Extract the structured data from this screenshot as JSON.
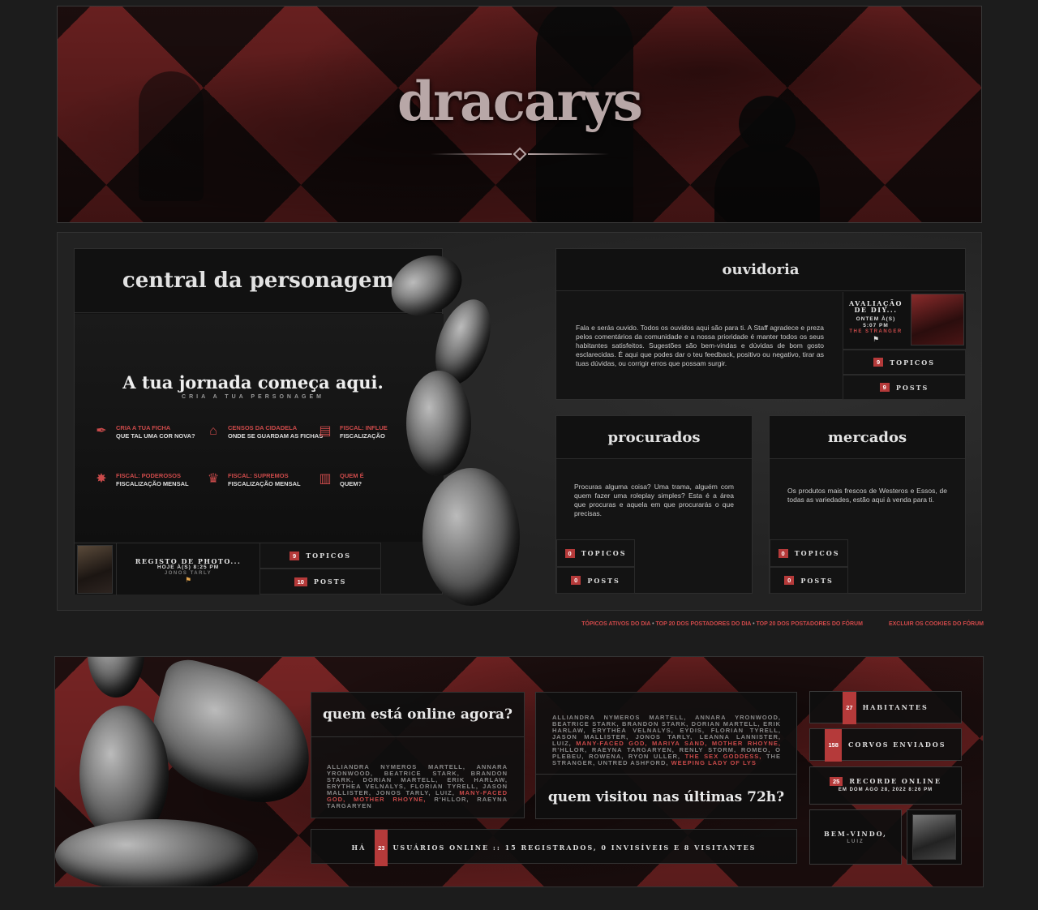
{
  "header": {
    "site_title": "dracarys"
  },
  "central": {
    "title": "central da personagem",
    "journey_title": "A tua jornada começa aqui.",
    "journey_subtitle": "CRIA A TUA PERSONAGEM",
    "links": [
      {
        "icon": "quill-icon",
        "glyph": "✒",
        "title": "CRIA A TUA FICHA",
        "subtitle": "QUE TAL UMA COR NOVA?"
      },
      {
        "icon": "building-icon",
        "glyph": "🏛",
        "title": "CENSOS DA CIDADELA",
        "subtitle": "ONDE SE GUARDAM AS FICHAS"
      },
      {
        "icon": "scroll-icon",
        "glyph": "📜",
        "title": "FISCAL: INFLUE",
        "subtitle": "FISCALIZAÇÃO"
      },
      {
        "icon": "compass-star-icon",
        "glyph": "✸",
        "title": "FISCAL: PODEROSOS",
        "subtitle": "FISCALIZAÇÃO MENSAL"
      },
      {
        "icon": "crown-icon",
        "glyph": "♛",
        "title": "FISCAL: SUPREMOS",
        "subtitle": "FISCALIZAÇÃO MENSAL"
      },
      {
        "icon": "books-icon",
        "glyph": "📚",
        "title": "QUEM É",
        "subtitle": "QUEM?"
      }
    ],
    "last_post": {
      "title": "REGISTO DE PHOTO...",
      "date": "HOJE À(S) 8:25 PM",
      "user": "JONOS TARLY"
    },
    "topics": "9",
    "topics_label": "TOPICOS",
    "posts": "10",
    "posts_label": "POSTS"
  },
  "ouvidoria": {
    "title": "ouvidoria",
    "description": "Fala e serás ouvido. Todos os ouvidos aqui são para ti. A Staff agradece e preza pelos comentários da comunidade e a nossa prioridade é manter todos os seus habitantes satisfeitos. Sugestões são bem-vindas e dúvidas de bom gosto esclarecidas. É aqui que podes dar o teu feedback, positivo ou negativo, tirar as tuas dúvidas, ou corrigir erros que possam surgir.",
    "last_post": {
      "title_line1": "AVALIAÇÃO",
      "title_line2": "DE DIY...",
      "date_line1": "ONTEM À(S)",
      "date_line2": "5:07 PM",
      "user": "THE STRANGER"
    },
    "topics": "9",
    "topics_label": "TOPICOS",
    "posts": "9",
    "posts_label": "POSTS"
  },
  "procurados": {
    "title": "procurados",
    "description": "Procuras alguma coisa? Uma trama, alguém com quem fazer uma roleplay simples? Esta é a área que procuras e aquela em que procurarás o que precisas.",
    "topics": "0",
    "topics_label": "TOPICOS",
    "posts": "0",
    "posts_label": "POSTS"
  },
  "mercados": {
    "title": "mercados",
    "description": "Os produtos mais frescos de Westeros e Essos, de todas as variedades, estão aqui à venda para ti.",
    "topics": "0",
    "topics_label": "TOPICOS",
    "posts": "0",
    "posts_label": "POSTS"
  },
  "footer_links": {
    "active_topics": "TÓPICOS ATIVOS DO DIA",
    "sep": " • ",
    "top20_day": "TOP 20 DOS POSTADORES DO DIA",
    "top20_forum": "TOP 20 DOS POSTADORES DO FÓRUM",
    "delete_cookies": "EXCLUIR OS COOKIES DO FÓRUM"
  },
  "online": {
    "online_title": "quem está online agora?",
    "online_names_plain": "ALLIANDRA NYMEROS MARTELL, ANNARA YRONWOOD, BEATRICE STARK, BRANDON STARK, DORIAN MARTELL, ERIK HARLAW, ERYTHEA VELNALYS, FLORIAN TYRELL, JASON MALLISTER, JONOS TARLY, LUIZ,",
    "online_names_red": "MANY-FACED GOD, MOTHER RHOYNE,",
    "online_names_tail": "R'HLLOR, RAEYNA TARGARYEN",
    "visited_title": "quem visitou nas últimas 72h?",
    "visited_names_plain": "ALLIANDRA NYMEROS MARTELL, ANNARA YRONWOOD, BEATRICE STARK, BRANDON STARK, DORIAN MARTELL, ERIK HARLAW, ERYTHEA VELNALYS, EYDIS, FLORIAN TYRELL, JASON MALLISTER, JONOS TARLY, LEANNA LANNISTER, LUIZ,",
    "visited_names_red1": "MANY-FACED GOD, MARIYA SAND, MOTHER RHOYNE,",
    "visited_names_mid": "R'HLLOR, RAEYNA TARGARYEN, RENLY STORM, ROMEO, O PLEBEU, ROWENA, RYON ULLER,",
    "visited_names_red2": "THE SEX GODDESS,",
    "visited_names_tail": "THE STRANGER, UNTRED ASHFORD,",
    "visited_names_red3": "WEEPING LADY OF LYS",
    "users_prefix": "HÁ",
    "users_count": "23",
    "users_suffix": "USUÁRIOS ONLINE :: 15 REGISTRADOS, 0 INVISÍVEIS E 8 VISITANTES",
    "stats": {
      "inhabitants": "27",
      "inhabitants_label": "HABITANTES",
      "ravens": "158",
      "ravens_label": "CORVOS ENVIADOS",
      "record": "25",
      "record_label": "RECORDE ONLINE",
      "record_date": "EM DOM AGO 28, 2022 8:26 PM"
    },
    "welcome": "BEM-VINDO,",
    "welcome_user": "LUIZ"
  },
  "colors": {
    "accent": "#c94a4a",
    "background": "#1c1c1c",
    "panel": "#141414"
  }
}
